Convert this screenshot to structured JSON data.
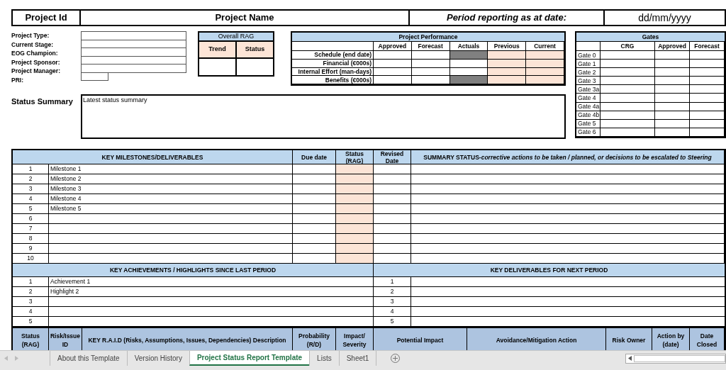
{
  "header": {
    "project_id_label": "Project Id",
    "project_name_label": "Project Name",
    "period_label": "Period reporting as at date:",
    "date_value": "dd/mm/yyyy"
  },
  "project_fields": [
    {
      "label": "Project Type:"
    },
    {
      "label": "Current Stage:"
    },
    {
      "label": "EOG Champion:"
    },
    {
      "label": "Project Sponsor:"
    },
    {
      "label": "Project Manager:"
    },
    {
      "label": "PRI:"
    }
  ],
  "overall_rag": {
    "title": "Overall RAG",
    "columns": [
      "Trend",
      "Status"
    ]
  },
  "project_performance": {
    "title": "Project Performance",
    "columns": [
      {
        "label": "Approved",
        "kind": "input"
      },
      {
        "label": "Forecast",
        "kind": "input"
      },
      {
        "label": "Actuals",
        "kind": "actuals"
      },
      {
        "label": "Previous",
        "kind": "highlight"
      },
      {
        "label": "Current",
        "kind": "highlight"
      }
    ],
    "rows": [
      {
        "label": "Schedule (end date)",
        "actuals_blocked": true
      },
      {
        "label": "Financial (€000s)",
        "actuals_blocked": false
      },
      {
        "label": "Internal Effort (man-days)",
        "actuals_blocked": false
      },
      {
        "label": "Benefits (€000s)",
        "actuals_blocked": true
      }
    ]
  },
  "gates": {
    "title": "Gates",
    "columns": [
      "CRG",
      "Approved",
      "Forecast"
    ],
    "rows": [
      "Gate 0",
      "Gate 1",
      "Gate 2",
      "Gate 3",
      "Gate 3a",
      "Gate 4",
      "Gate 4a",
      "Gate 4b",
      "Gate 5",
      "Gate 6"
    ]
  },
  "status_summary": {
    "label": "Status Summary",
    "value": "Latest status summary"
  },
  "milestones": {
    "columns": [
      {
        "label": "KEY MILESTONES/DELIVERABLES",
        "kind": "plain"
      },
      {
        "label": "Due date",
        "kind": "plain"
      },
      {
        "label": "Status (RAG)",
        "kind": "highlight"
      },
      {
        "label": "Revised Date",
        "kind": "plain"
      },
      {
        "label": "**SUMMARY STATUS**-*corrective actions to be taken / planned, or decisions to be escalated to Steering*",
        "kind": "plain"
      }
    ],
    "rows": [
      {
        "number": "1",
        "description": "Milestone 1"
      },
      {
        "number": "2",
        "description": "Milestone 2"
      },
      {
        "number": "3",
        "description": "Milestone 3"
      },
      {
        "number": "4",
        "description": "Milestone 4"
      },
      {
        "number": "5",
        "description": "Milestone 5"
      },
      {
        "number": "6"
      },
      {
        "number": "7"
      },
      {
        "number": "8"
      },
      {
        "number": "9"
      },
      {
        "number": "10"
      }
    ]
  },
  "achievements": {
    "title": "KEY ACHIEVEMENTS / HIGHLIGHTS SINCE LAST PERIOD",
    "rows": [
      {
        "number": "1",
        "description": "Achievement 1"
      },
      {
        "number": "2",
        "description": "Highlight 2"
      },
      {
        "number": "3"
      },
      {
        "number": "4"
      },
      {
        "number": "5"
      }
    ]
  },
  "next_deliverables": {
    "title": "KEY DELIVERABLES FOR NEXT PERIOD",
    "rows": [
      {
        "number": "1"
      },
      {
        "number": "2"
      },
      {
        "number": "3"
      },
      {
        "number": "4"
      },
      {
        "number": "5"
      }
    ]
  },
  "raid": {
    "columns": [
      "Status (RAG)",
      "Risk/Issue ID",
      "KEY R.A.I.D (Risks, Assumptions, Issues, Dependencies) Description",
      "Probability (R/D)",
      "Impact/ Severity",
      "Potential Impact",
      "Avoidance/Mitigation Action",
      "Risk Owner",
      "Action by (date)",
      "Date Closed"
    ]
  },
  "sheet_tabs": [
    {
      "label": "About this Template",
      "selected": false
    },
    {
      "label": "Version History",
      "selected": false
    },
    {
      "label": "Project Status Report Template",
      "selected": true
    },
    {
      "label": "Lists",
      "selected": false
    },
    {
      "label": "Sheet1",
      "selected": false
    }
  ]
}
